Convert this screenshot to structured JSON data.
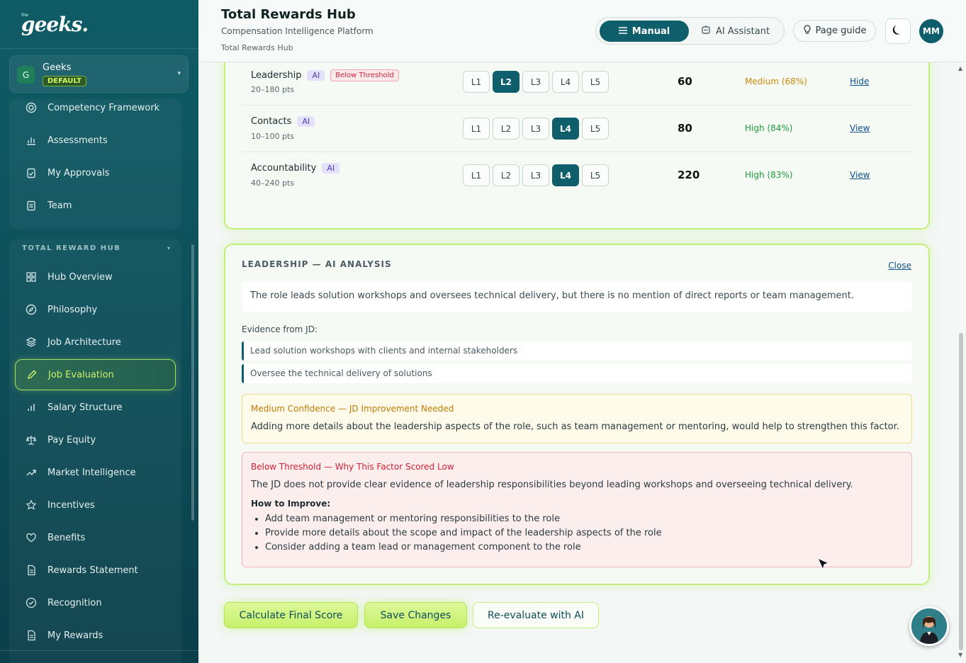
{
  "sidebar": {
    "logo": "geeks.",
    "logo_sup": "the",
    "org": {
      "initial": "G",
      "name": "Geeks",
      "badge": "DEFAULT"
    },
    "top_items": [
      {
        "label": "Competency Framework",
        "icon": "target-icon"
      },
      {
        "label": "Assessments",
        "icon": "bar-chart-icon"
      },
      {
        "label": "My Approvals",
        "icon": "clipboard-check-icon"
      },
      {
        "label": "Team",
        "icon": "clipboard-icon"
      }
    ],
    "group_label": "TOTAL REWARD HUB",
    "group_items": [
      {
        "label": "Hub Overview",
        "icon": "grid-icon"
      },
      {
        "label": "Philosophy",
        "icon": "compass-icon"
      },
      {
        "label": "Job Architecture",
        "icon": "layers-icon"
      },
      {
        "label": "Job Evaluation",
        "icon": "pencil-icon"
      },
      {
        "label": "Salary Structure",
        "icon": "bars-icon"
      },
      {
        "label": "Pay Equity",
        "icon": "scale-icon"
      },
      {
        "label": "Market Intelligence",
        "icon": "trend-icon"
      },
      {
        "label": "Incentives",
        "icon": "star-icon"
      },
      {
        "label": "Benefits",
        "icon": "heart-icon"
      },
      {
        "label": "Rewards Statement",
        "icon": "document-icon"
      },
      {
        "label": "Recognition",
        "icon": "check-circle-icon"
      },
      {
        "label": "My Rewards",
        "icon": "document-icon"
      }
    ],
    "active_item": "Job Evaluation"
  },
  "header": {
    "title": "Total Rewards Hub",
    "subtitle": "Compensation Intelligence Platform",
    "breadcrumb": "Total Rewards Hub",
    "mode_manual": "Manual",
    "mode_ai": "AI Assistant",
    "page_guide": "Page guide",
    "user_initials": "MM"
  },
  "factors": [
    {
      "name": "Leadership",
      "ai": "AI",
      "flag": "Below Threshold",
      "range": "20–180 pts",
      "levels": [
        "L1",
        "L2",
        "L3",
        "L4",
        "L5"
      ],
      "selected": "L2",
      "score": "60",
      "confidence": "Medium (68%)",
      "confidence_color": "#c88a08",
      "link": "Hide"
    },
    {
      "name": "Contacts",
      "ai": "AI",
      "flag": "",
      "range": "10–100 pts",
      "levels": [
        "L1",
        "L2",
        "L3",
        "L4",
        "L5"
      ],
      "selected": "L4",
      "score": "80",
      "confidence": "High (84%)",
      "confidence_color": "#1f9a3a",
      "link": "View"
    },
    {
      "name": "Accountability",
      "ai": "AI",
      "flag": "",
      "range": "40–240 pts",
      "levels": [
        "L1",
        "L2",
        "L3",
        "L4",
        "L5"
      ],
      "selected": "L4",
      "score": "220",
      "confidence": "High (83%)",
      "confidence_color": "#1f9a3a",
      "link": "View"
    }
  ],
  "analysis": {
    "title": "LEADERSHIP — AI ANALYSIS",
    "close": "Close",
    "summary": "The role leads solution workshops and oversees technical delivery, but there is no mention of direct reports or team management.",
    "evidence_label": "Evidence from JD:",
    "evidence": [
      "Lead solution workshops with clients and internal stakeholders",
      "Oversee the technical delivery of solutions"
    ],
    "confidence_title": "Medium Confidence — JD Improvement Needed",
    "confidence_text": "Adding more details about the leadership aspects of the role, such as team management or mentoring, would help to strengthen this factor.",
    "low_title": "Below Threshold — Why This Factor Scored Low",
    "low_text": "The JD does not provide clear evidence of leadership responsibilities beyond leading workshops and overseeing technical delivery.",
    "how_label": "How to Improve:",
    "tips": [
      "Add team management or mentoring responsibilities to the role",
      "Provide more details about the scope and impact of the leadership aspects of the role",
      "Consider adding a team lead or management component to the role"
    ]
  },
  "actions": {
    "calculate": "Calculate Final Score",
    "save": "Save Changes",
    "reevaluate": "Re-evaluate with AI"
  }
}
